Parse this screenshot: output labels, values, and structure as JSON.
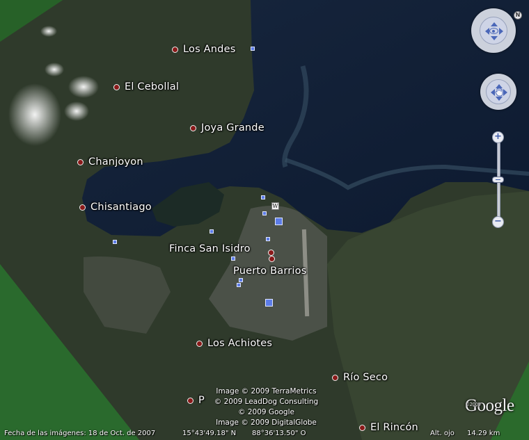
{
  "places": [
    {
      "id": "los-andes",
      "name": "Los Andes"
    },
    {
      "id": "el-cebollal",
      "name": "El Cebollal"
    },
    {
      "id": "joya-grande",
      "name": "Joya Grande"
    },
    {
      "id": "chanjoyon",
      "name": "Chanjoyon"
    },
    {
      "id": "chisantiago",
      "name": "Chisantiago"
    },
    {
      "id": "finca-san-isidro",
      "name": "Finca San Isidro"
    },
    {
      "id": "puerto-barrios",
      "name": "Puerto Barrios"
    },
    {
      "id": "los-achiotes",
      "name": "Los Achiotes"
    },
    {
      "id": "rio-seco",
      "name": "Río Seco"
    },
    {
      "id": "el-rincon",
      "name": "El Rincón"
    },
    {
      "id": "p-partial",
      "name": "P"
    }
  ],
  "credits": [
    "Image © 2009 TerraMetrics",
    "© 2009 LeadDog Consulting",
    "© 2009 Google",
    "Image © 2009 DigitalGlobe"
  ],
  "status": {
    "imagery_date": "Fecha de las imágenes: 18 de Oct. de 2007",
    "latitude": "15°43'49.18\" N",
    "longitude": "88°36'13.50\" O",
    "eye_alt_label": "Alt. ojo",
    "eye_alt_value": "14.29 km"
  },
  "logo": {
    "text": "Google",
    "year": "©2009"
  },
  "controls": {
    "north": "N",
    "zoom_in": "+",
    "zoom_out": "−"
  },
  "icons": {
    "wikipedia": "W",
    "compass": "navigation-ring-icon",
    "look": "eye-icon",
    "pan": "hand-icon",
    "photo_marker": "photo-square-icon"
  },
  "colors": {
    "water": "#10203a",
    "land": "#2f3b2a",
    "vegetation": "#2f6a2a",
    "place_dot": "#8a1a1a",
    "photo_marker": "#5c7ce8"
  }
}
